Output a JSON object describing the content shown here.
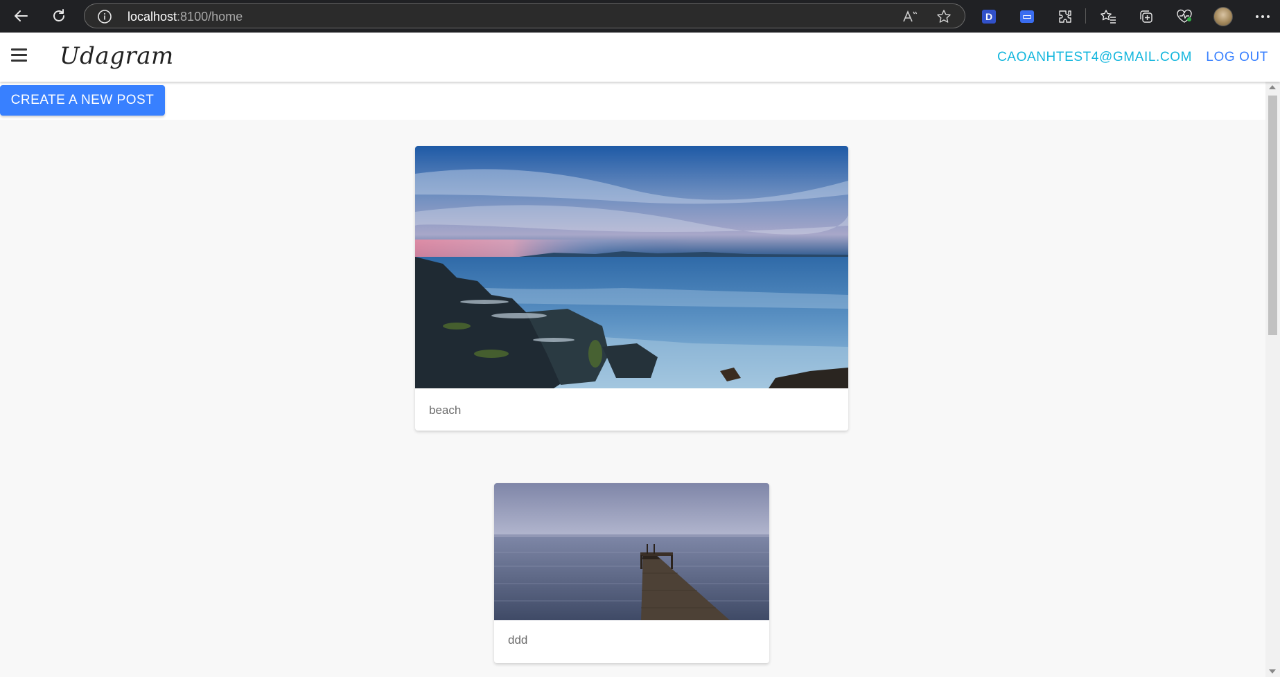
{
  "browser": {
    "url_host": "localhost",
    "url_path": ":8100/home",
    "ext_d_label": "D"
  },
  "app": {
    "title": "Udagram",
    "user_email": "CAOANHTEST4@GMAIL.COM",
    "logout_label": "LOG OUT",
    "create_post_label": "CREATE A NEW POST",
    "accent_color": "#3880ff",
    "email_color": "#13b6dd"
  },
  "feed": {
    "posts": [
      {
        "caption": "beach",
        "image": "rocky-shore-sunset-photo"
      },
      {
        "caption": "ddd",
        "image": "lake-pier-photo"
      }
    ]
  },
  "icons": [
    "back-arrow-icon",
    "refresh-icon",
    "info-icon",
    "read-aloud-icon",
    "favorite-star-icon",
    "extensions-icon",
    "favorites-icon",
    "collections-icon",
    "browser-essentials-icon",
    "profile-avatar",
    "more-icon",
    "hamburger-menu-icon"
  ]
}
